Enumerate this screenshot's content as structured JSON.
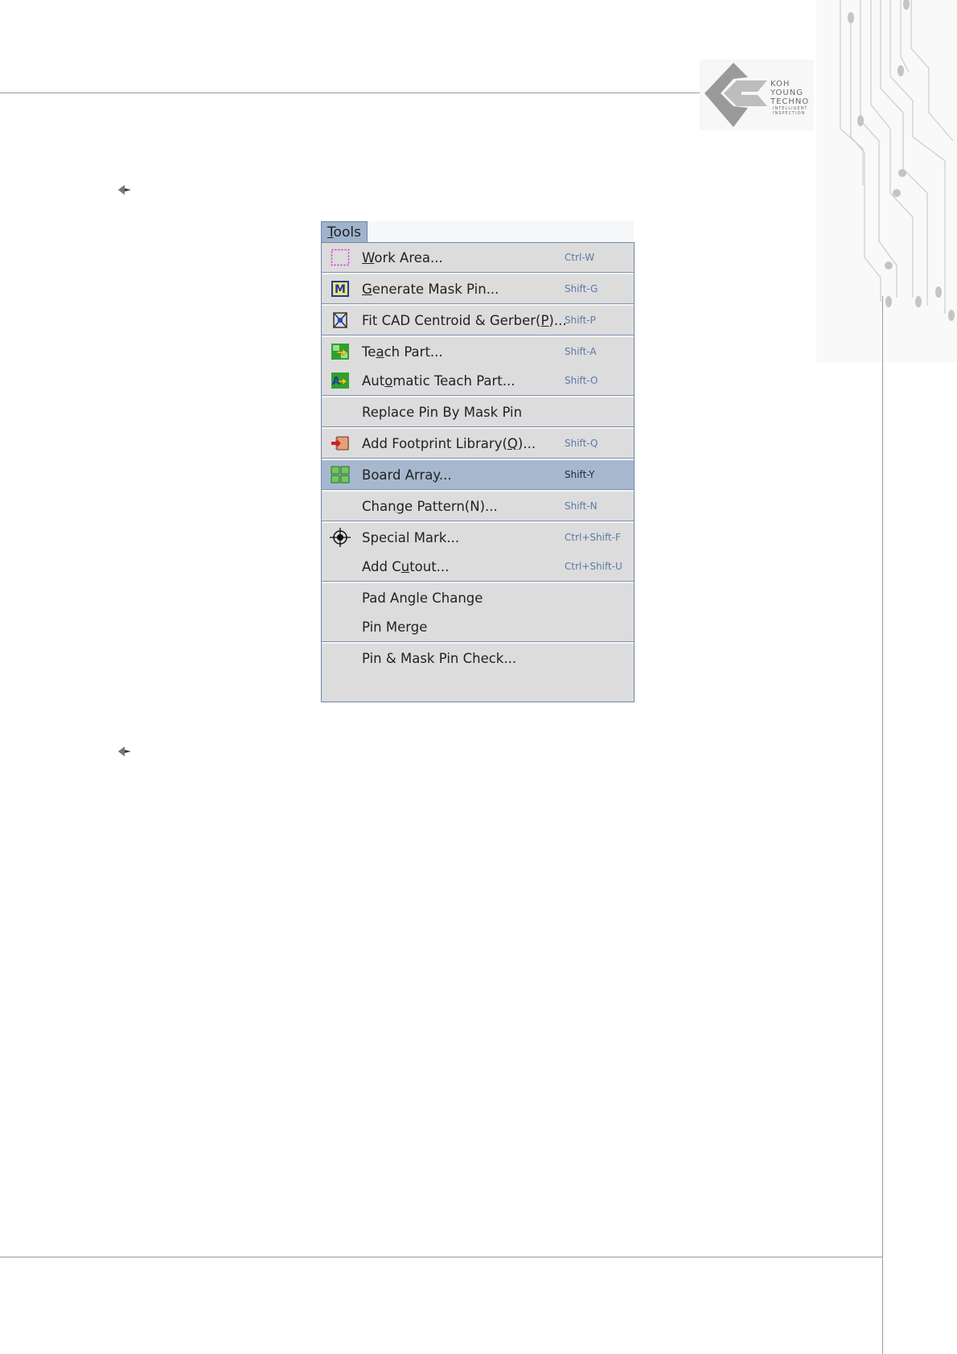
{
  "logo": {
    "line1": "KOH",
    "line2": "YOUNG",
    "line3": "TECHNO",
    "tagline1": "INTELLIGENT",
    "tagline2": "INSPECTION"
  },
  "menu": {
    "title": "Tools",
    "title_underline_char": "T",
    "groups": [
      [
        {
          "icon": "work-area-icon",
          "label": "Work Area...",
          "underline": "W",
          "shortcut": "Ctrl-W"
        }
      ],
      [
        {
          "icon": "mask-pin-icon",
          "label": "Generate Mask Pin...",
          "underline": "G",
          "shortcut": "Shift-G"
        }
      ],
      [
        {
          "icon": "fit-cad-icon",
          "label": "Fit CAD Centroid & Gerber(P)...",
          "underline": "P",
          "shortcut": "Shift-P"
        }
      ],
      [
        {
          "icon": "teach-part-icon",
          "label": "Teach Part...",
          "underline": "a",
          "shortcut": "Shift-A"
        },
        {
          "icon": "auto-teach-icon",
          "label": "Automatic Teach Part...",
          "underline": "o",
          "shortcut": "Shift-O"
        }
      ],
      [
        {
          "icon": "",
          "label": "Replace Pin By Mask Pin",
          "underline": "",
          "shortcut": ""
        }
      ],
      [
        {
          "icon": "footprint-library-icon",
          "label": "Add Footprint Library(Q)...",
          "underline": "Q",
          "shortcut": "Shift-Q"
        }
      ],
      [
        {
          "icon": "board-array-icon",
          "label": "Board Array...",
          "underline": "y",
          "shortcut": "Shift-Y",
          "highlighted": true
        }
      ],
      [
        {
          "icon": "",
          "label": "Change Pattern(N)...",
          "underline": "g",
          "shortcut": "Shift-N"
        }
      ],
      [
        {
          "icon": "special-mark-icon",
          "label": "Special Mark...",
          "underline": "",
          "shortcut": "Ctrl+Shift-F"
        },
        {
          "icon": "",
          "label": "Add Cutout...",
          "underline": "u",
          "shortcut": "Ctrl+Shift-U"
        }
      ],
      [
        {
          "icon": "",
          "label": "Pad Angle Change",
          "underline": "",
          "shortcut": ""
        },
        {
          "icon": "",
          "label": "Pin Merge",
          "underline": "",
          "shortcut": ""
        }
      ],
      [
        {
          "icon": "",
          "label": "Pin & Mask Pin Check...",
          "underline": "",
          "shortcut": ""
        }
      ]
    ]
  }
}
